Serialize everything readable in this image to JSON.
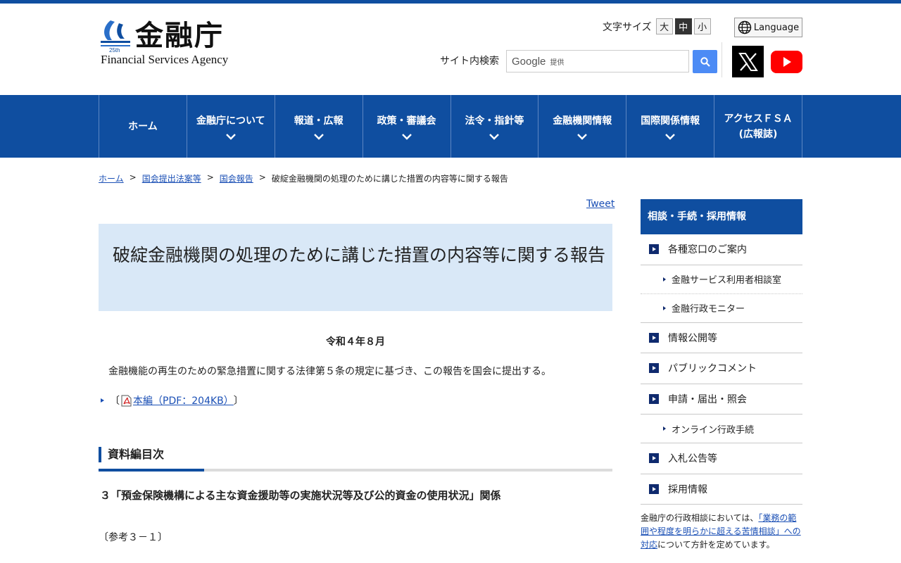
{
  "logo": {
    "kanji": "金融庁",
    "english": "Financial Services Agency",
    "mark_text": "25th"
  },
  "header": {
    "font_size_label": "文字サイズ",
    "font_sizes": [
      "大",
      "中",
      "小"
    ],
    "font_size_selected": "中",
    "language_label": "Language",
    "search_label": "サイト内検索",
    "search_brand": "Google",
    "search_brand_suffix": "提供",
    "social": [
      "x-icon",
      "youtube-icon"
    ]
  },
  "nav": {
    "items": [
      {
        "label": "ホーム",
        "has_dropdown": false
      },
      {
        "label": "金融庁について",
        "has_dropdown": true
      },
      {
        "label": "報道・広報",
        "has_dropdown": true
      },
      {
        "label": "政策・審議会",
        "has_dropdown": true
      },
      {
        "label": "法令・指針等",
        "has_dropdown": true
      },
      {
        "label": "金融機関情報",
        "has_dropdown": true
      },
      {
        "label": "国際関係情報",
        "has_dropdown": true
      },
      {
        "label": "アクセスＦＳＡ",
        "label2": "(広報誌)",
        "has_dropdown": false
      }
    ]
  },
  "breadcrumb": {
    "items": [
      "ホーム",
      "国会提出法案等",
      "国会報告"
    ],
    "current": "破綻金融機関の処理のために講じた措置の内容等に関する報告",
    "separator": ">"
  },
  "main": {
    "tweet": "Tweet",
    "title": "破綻金融機関の処理のために講じた措置の内容等に関する報告",
    "date": "令和４年８月",
    "paragraph": "金融機能の再生のための緊急措置に関する法律第５条の規定に基づき、この報告を国会に提出する。",
    "pdf_open": "〔",
    "pdf_link": "本編（PDF：204KB）",
    "pdf_close": "〕",
    "section_heading": "資料編目次",
    "subheading": "３「預金保険機構による主な資金援助等の実施状況等及び公的資金の使用状況」関係",
    "reference": "〔参考３－１〕"
  },
  "sidebar": {
    "heading": "相談・手続・採用情報",
    "items": [
      {
        "label": "各種窓口のご案内",
        "level": 1
      },
      {
        "label": "金融サービス利用者相談室",
        "level": 2
      },
      {
        "label": "金融行政モニター",
        "level": 2
      },
      {
        "label": "情報公開等",
        "level": 1
      },
      {
        "label": "パブリックコメント",
        "level": 1
      },
      {
        "label": "申請・届出・照会",
        "level": 1
      },
      {
        "label": "オンライン行政手続",
        "level": 2
      },
      {
        "label": "入札公告等",
        "level": 1
      },
      {
        "label": "採用情報",
        "level": 1
      }
    ],
    "note_prefix": "金融庁の行政相談においては、",
    "note_link": "「業務の範囲や程度を明らかに超える苦情相談」への対応",
    "note_suffix": "について方針を定めています。"
  },
  "colors": {
    "brand_blue": "#0f4ea0",
    "title_bg": "#d9e8f7",
    "link": "#1a4fb5",
    "youtube_red": "#ff0000",
    "search_blue": "#4c8bf5"
  }
}
